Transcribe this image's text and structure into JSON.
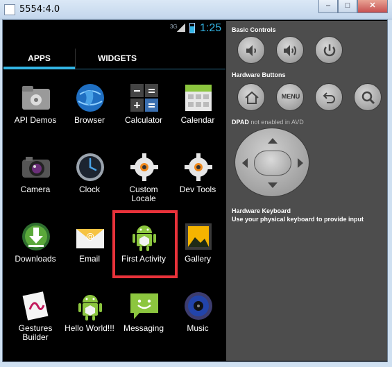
{
  "window": {
    "title": "5554:4.0",
    "minimize": "–",
    "maximize": "□",
    "close": "✕"
  },
  "statusbar": {
    "network": "3G",
    "time": "1:25"
  },
  "tabs": [
    {
      "label": "APPS"
    },
    {
      "label": "WIDGETS"
    }
  ],
  "apps": [
    {
      "label": "API Demos",
      "icon": "folder-gear-icon"
    },
    {
      "label": "Browser",
      "icon": "globe-icon"
    },
    {
      "label": "Calculator",
      "icon": "calculator-icon"
    },
    {
      "label": "Calendar",
      "icon": "calendar-icon"
    },
    {
      "label": "Camera",
      "icon": "camera-icon"
    },
    {
      "label": "Clock",
      "icon": "clock-icon"
    },
    {
      "label": "Custom\nLocale",
      "icon": "gear-icon"
    },
    {
      "label": "Dev Tools",
      "icon": "gear-icon"
    },
    {
      "label": "Downloads",
      "icon": "download-icon"
    },
    {
      "label": "Email",
      "icon": "email-icon"
    },
    {
      "label": "First Activity",
      "icon": "android-icon"
    },
    {
      "label": "Gallery",
      "icon": "gallery-icon"
    },
    {
      "label": "Gestures\nBuilder",
      "icon": "gestures-icon"
    },
    {
      "label": "Hello World!!!",
      "icon": "android-icon"
    },
    {
      "label": "Messaging",
      "icon": "messaging-icon"
    },
    {
      "label": "Music",
      "icon": "music-icon"
    }
  ],
  "panel": {
    "basic_controls": "Basic Controls",
    "hardware_buttons": "Hardware Buttons",
    "menu_label": "MENU",
    "dpad_title": "DPAD",
    "dpad_note": "not enabled in AVD",
    "keyboard_title": "Hardware Keyboard",
    "keyboard_hint": "Use your physical keyboard to provide input"
  },
  "colors": {
    "accent": "#33b5e5",
    "highlight": "#e8323a",
    "panel": "#4d4d4d"
  }
}
